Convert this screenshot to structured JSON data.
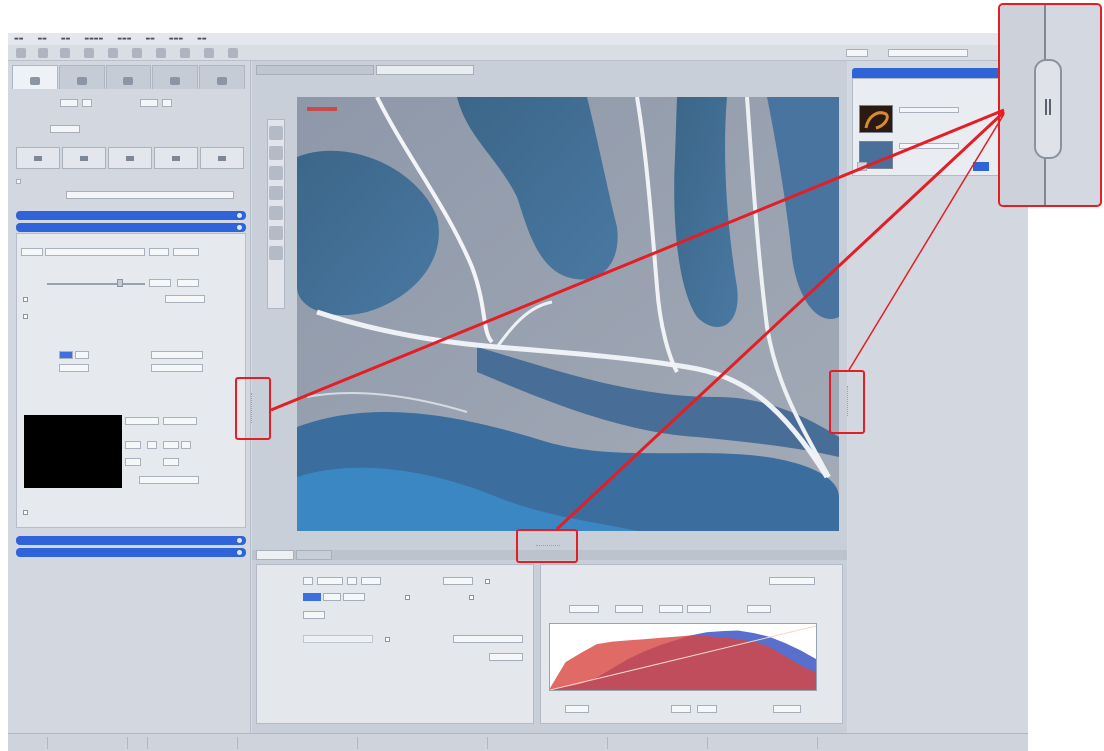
{
  "colors": {
    "accent_blue": "#2e63d9",
    "callout_red": "#e31e24",
    "image_blue": "#3f6c9a",
    "image_gray": "#a7adb9",
    "hist_red": "#d8453f",
    "hist_blue": "#3c56c6"
  },
  "icons": {
    "splitter_handle": "grip-vertical-icon",
    "view_tools": [
      "2d-view-icon",
      "split-view-icon",
      "gallery-icon",
      "profile-icon",
      "info-icon",
      "histogram-icon"
    ]
  },
  "histogram": {
    "red_channel": [
      0.03,
      0.45,
      0.6,
      0.74,
      0.78,
      0.8,
      0.82,
      0.84,
      0.86,
      0.88,
      0.87,
      0.85,
      0.82,
      0.78,
      0.7,
      0.55,
      0.4,
      0.28
    ],
    "blue_channel": [
      0.01,
      0.05,
      0.1,
      0.2,
      0.35,
      0.5,
      0.62,
      0.72,
      0.8,
      0.88,
      0.93,
      0.95,
      0.96,
      0.92,
      0.86,
      0.76,
      0.64,
      0.5
    ]
  },
  "callouts": [
    {
      "name": "left-splitter-handle"
    },
    {
      "name": "bottom-splitter-handle"
    },
    {
      "name": "right-splitter-handle"
    }
  ]
}
